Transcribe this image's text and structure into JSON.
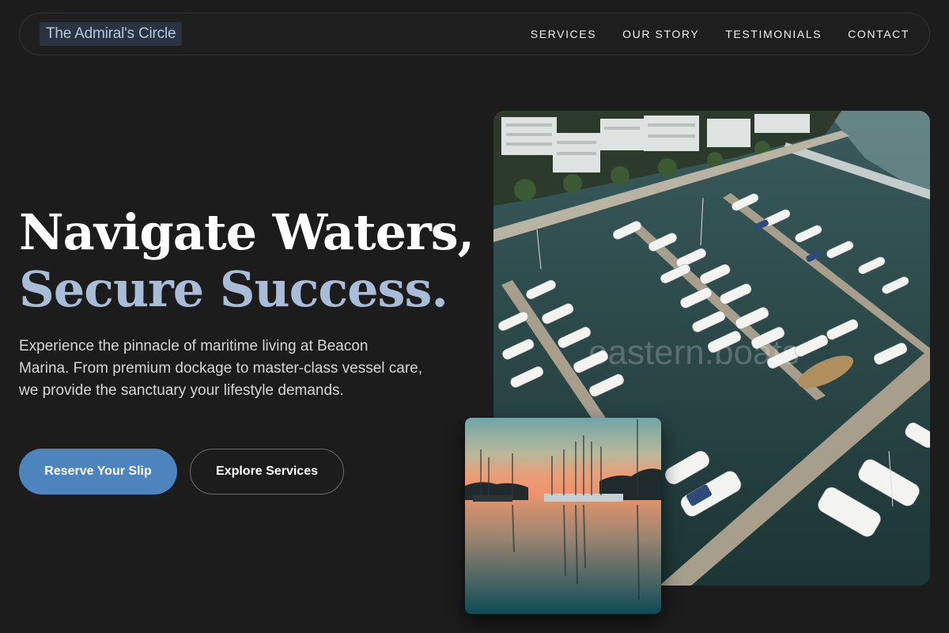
{
  "header": {
    "logo": "The Admiral's Circle",
    "nav": [
      {
        "label": "SERVICES"
      },
      {
        "label": "OUR STORY"
      },
      {
        "label": "TESTIMONIALS"
      },
      {
        "label": "CONTACT"
      }
    ]
  },
  "hero": {
    "headline_line1": "Navigate Waters,",
    "headline_line2": "Secure Success.",
    "description": "Experience the pinnacle of maritime living at Beacon Marina. From premium dockage to master-class vessel care, we provide the sanctuary your lifestyle demands.",
    "primary_button": "Reserve Your Slip",
    "secondary_button": "Explore Services"
  },
  "images": {
    "main_watermark": "eastern.boats"
  },
  "colors": {
    "background": "#1c1c1c",
    "accent": "#4e84bd",
    "headline_accent": "#a9bdd9",
    "logo_bg": "#2a3440"
  }
}
